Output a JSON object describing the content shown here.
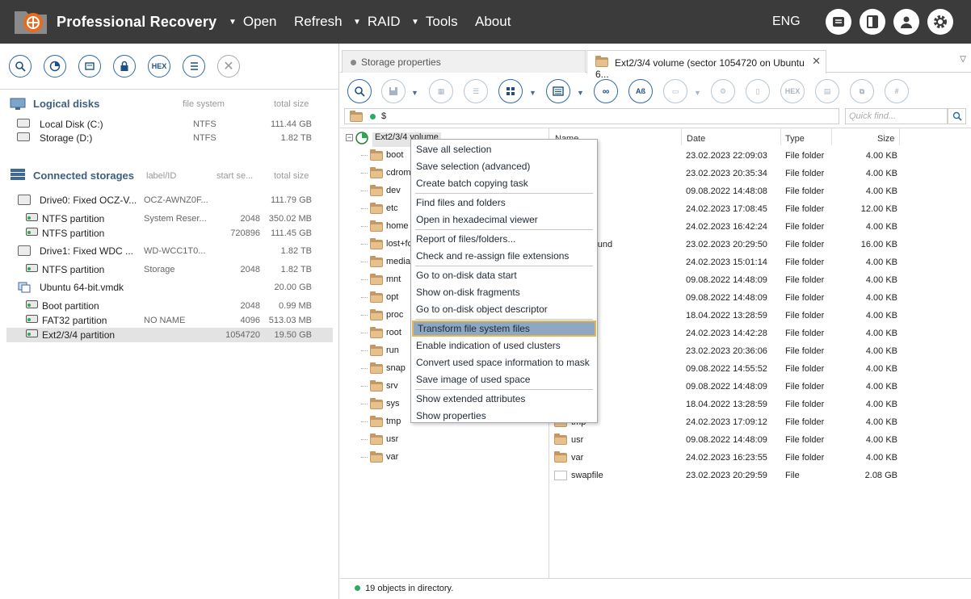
{
  "header": {
    "title": "Professional Recovery",
    "menu": [
      "Open",
      "Refresh",
      "RAID",
      "Tools",
      "About"
    ],
    "lang": "ENG"
  },
  "left": {
    "toolbar": {
      "hex_label": "HEX"
    },
    "logical": {
      "title": "Logical disks",
      "col_fs": "file system",
      "col_size": "total size",
      "items": [
        {
          "name": "Local Disk (C:)",
          "fs": "NTFS",
          "size": "111.44 GB"
        },
        {
          "name": "Storage (D:)",
          "fs": "NTFS",
          "size": "1.82 TB"
        }
      ]
    },
    "connected": {
      "title": "Connected storages",
      "col_label": "label/ID",
      "col_start": "start se...",
      "col_size": "total size",
      "items": [
        {
          "name": "Drive0: Fixed OCZ-V...",
          "label": "OCZ-AWNZ0F...",
          "start": "",
          "size": "111.79 GB"
        },
        {
          "name": "NTFS partition",
          "label": "System Reser...",
          "start": "2048",
          "size": "350.02 MB"
        },
        {
          "name": "NTFS partition",
          "label": "",
          "start": "720896",
          "size": "111.45 GB"
        },
        {
          "name": "Drive1: Fixed WDC ...",
          "label": "WD-WCC1T0...",
          "start": "",
          "size": "1.82 TB"
        },
        {
          "name": "NTFS partition",
          "label": "Storage",
          "start": "2048",
          "size": "1.82 TB"
        },
        {
          "name": "Ubuntu 64-bit.vmdk",
          "label": "",
          "start": "",
          "size": "20.00 GB"
        },
        {
          "name": "Boot partition",
          "label": "",
          "start": "2048",
          "size": "0.99 MB"
        },
        {
          "name": "FAT32 partition",
          "label": "NO NAME",
          "start": "4096",
          "size": "513.03 MB"
        },
        {
          "name": "Ext2/3/4 partition",
          "label": "",
          "start": "1054720",
          "size": "19.50 GB"
        }
      ]
    }
  },
  "right": {
    "tabs": [
      "Storage properties",
      "Ext2/3/4 volume (sector 1054720 on Ubuntu 6..."
    ],
    "toolbar": {
      "hex_label": "HEX",
      "ab_label": "Aß",
      "num_label": "#"
    },
    "path": "$",
    "quickfind_placeholder": "Quick find...",
    "tree_root": "Ext2/3/4 volume",
    "tree": [
      "boot",
      "cdrom",
      "dev",
      "etc",
      "home",
      "lost+found",
      "media",
      "mnt",
      "opt",
      "proc",
      "root",
      "run",
      "snap",
      "srv",
      "sys",
      "tmp",
      "usr",
      "var"
    ],
    "columns": {
      "name": "Name",
      "date": "Date",
      "type": "Type",
      "size": "Size"
    },
    "files": [
      {
        "name": "boot",
        "date": "23.02.2023 22:09:03",
        "type": "File folder",
        "size": "4.00 KB"
      },
      {
        "name": "cdrom",
        "date": "23.02.2023 20:35:34",
        "type": "File folder",
        "size": "4.00 KB"
      },
      {
        "name": "dev",
        "date": "09.08.2022 14:48:08",
        "type": "File folder",
        "size": "4.00 KB"
      },
      {
        "name": "etc",
        "date": "24.02.2023 17:08:45",
        "type": "File folder",
        "size": "12.00 KB"
      },
      {
        "name": "home",
        "date": "24.02.2023 16:42:24",
        "type": "File folder",
        "size": "4.00 KB"
      },
      {
        "name": "lost+found",
        "date": "23.02.2023 20:29:50",
        "type": "File folder",
        "size": "16.00 KB"
      },
      {
        "name": "media",
        "date": "24.02.2023 15:01:14",
        "type": "File folder",
        "size": "4.00 KB"
      },
      {
        "name": "mnt",
        "date": "09.08.2022 14:48:09",
        "type": "File folder",
        "size": "4.00 KB"
      },
      {
        "name": "opt",
        "date": "09.08.2022 14:48:09",
        "type": "File folder",
        "size": "4.00 KB"
      },
      {
        "name": "proc",
        "date": "18.04.2022 13:28:59",
        "type": "File folder",
        "size": "4.00 KB"
      },
      {
        "name": "root",
        "date": "24.02.2023 14:42:28",
        "type": "File folder",
        "size": "4.00 KB"
      },
      {
        "name": "run",
        "date": "23.02.2023 20:36:06",
        "type": "File folder",
        "size": "4.00 KB"
      },
      {
        "name": "snap",
        "date": "09.08.2022 14:55:52",
        "type": "File folder",
        "size": "4.00 KB"
      },
      {
        "name": "srv",
        "date": "09.08.2022 14:48:09",
        "type": "File folder",
        "size": "4.00 KB"
      },
      {
        "name": "sys",
        "date": "18.04.2022 13:28:59",
        "type": "File folder",
        "size": "4.00 KB"
      },
      {
        "name": "tmp",
        "date": "24.02.2023 17:09:12",
        "type": "File folder",
        "size": "4.00 KB"
      },
      {
        "name": "usr",
        "date": "09.08.2022 14:48:09",
        "type": "File folder",
        "size": "4.00 KB"
      },
      {
        "name": "var",
        "date": "24.02.2023 16:23:55",
        "type": "File folder",
        "size": "4.00 KB"
      },
      {
        "name": "swapfile",
        "date": "23.02.2023 20:29:59",
        "type": "File",
        "size": "2.08 GB"
      }
    ],
    "status": "19 objects in directory."
  },
  "context_menu": {
    "groups": [
      [
        "Save all selection",
        "Save selection (advanced)",
        "Create batch copying task"
      ],
      [
        "Find files and folders",
        "Open in hexadecimal viewer"
      ],
      [
        "Report of files/folders...",
        "Check and re-assign file extensions"
      ],
      [
        "Go to on-disk data start",
        "Show on-disk fragments",
        "Go to on-disk object descriptor"
      ],
      [
        "Transform file system files",
        "Enable indication of used clusters",
        "Convert used space information to mask",
        "Save image of used space"
      ],
      [
        "Show extended attributes",
        "Show properties"
      ]
    ],
    "highlighted": "Transform file system files"
  },
  "colors": {
    "header_bg": "#3b3b3b",
    "accent": "#2d6aa8",
    "highlight": "#8ea8c4",
    "highlight_border": "#e4b556"
  }
}
